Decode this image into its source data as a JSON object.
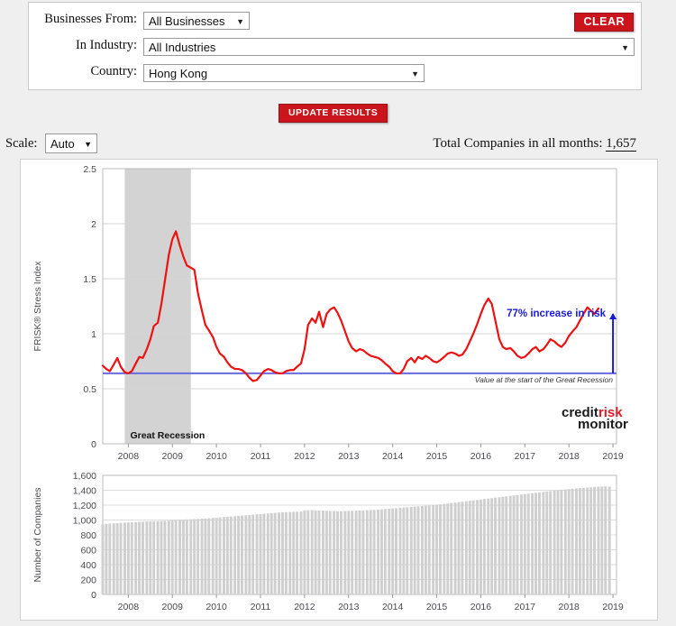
{
  "filters": {
    "businesses_from": {
      "label": "Businesses From:",
      "value": "All Businesses",
      "caret": "chevron-down-icon"
    },
    "in_industry": {
      "label": "In Industry:",
      "value": "All Industries",
      "caret": "chevron-down-icon"
    },
    "country": {
      "label": "Country:",
      "value": "Hong Kong",
      "caret": "chevron-down-icon"
    },
    "clear_label": "CLEAR"
  },
  "update_results_label": "UPDATE RESULTS",
  "scale": {
    "label": "Scale:",
    "value": "Auto",
    "caret": "chevron-down-icon"
  },
  "totals": {
    "prefix": "Total Companies in all months:",
    "value": "1,657"
  },
  "logo": {
    "part1": "credit",
    "part2": "risk",
    "part3": "monitor"
  },
  "colors": {
    "accent_red": "#c9151b",
    "line_red": "#ee1111",
    "baseline_blue": "#6a6ae0",
    "annotation_blue": "#1a1ad6",
    "recession_band": "#d3d3d3",
    "bar_gray": "#cfcfcf"
  },
  "chart_data": [
    {
      "type": "line",
      "id": "frisk-stress-index",
      "title": "",
      "xlabel": "",
      "ylabel": "FRISK® Stress Index",
      "ylim": [
        0,
        2.5
      ],
      "yticks": [
        0,
        0.5,
        1,
        1.5,
        2,
        2.5
      ],
      "ytick_labels": [
        "0",
        "0.5",
        "1",
        "1.5",
        "2",
        "2.5"
      ],
      "xlim": [
        2007.42,
        2019.08
      ],
      "xticks": [
        2008,
        2009,
        2010,
        2011,
        2012,
        2013,
        2014,
        2015,
        2016,
        2017,
        2018,
        2019
      ],
      "xtick_labels": [
        "2008",
        "2009",
        "2010",
        "2011",
        "2012",
        "2013",
        "2014",
        "2015",
        "2016",
        "2017",
        "2018",
        "2019"
      ],
      "grid": true,
      "legend": "none",
      "annotations": [
        {
          "name": "great-recession-band",
          "text": "Great Recession",
          "x_start": 2007.92,
          "x_end": 2009.42
        },
        {
          "name": "baseline-label",
          "text": "Value at the start of the Great Recession",
          "y": 0.64
        },
        {
          "name": "increase-callout",
          "text": "77% increase in risk"
        }
      ],
      "baseline_value": 0.64,
      "series": [
        {
          "name": "FRISK® Stress Index",
          "color": "#ee1111",
          "x": [
            2007.42,
            2007.5,
            2007.58,
            2007.67,
            2007.75,
            2007.83,
            2007.92,
            2008.0,
            2008.08,
            2008.17,
            2008.25,
            2008.33,
            2008.42,
            2008.5,
            2008.58,
            2008.67,
            2008.75,
            2008.83,
            2008.92,
            2009.0,
            2009.08,
            2009.17,
            2009.25,
            2009.33,
            2009.42,
            2009.5,
            2009.58,
            2009.67,
            2009.75,
            2009.83,
            2009.92,
            2010.0,
            2010.08,
            2010.17,
            2010.25,
            2010.33,
            2010.42,
            2010.5,
            2010.58,
            2010.67,
            2010.75,
            2010.83,
            2010.92,
            2011.0,
            2011.08,
            2011.17,
            2011.25,
            2011.33,
            2011.42,
            2011.5,
            2011.58,
            2011.67,
            2011.75,
            2011.83,
            2011.92,
            2012.0,
            2012.08,
            2012.17,
            2012.25,
            2012.33,
            2012.42,
            2012.5,
            2012.58,
            2012.67,
            2012.75,
            2012.83,
            2012.92,
            2013.0,
            2013.08,
            2013.17,
            2013.25,
            2013.33,
            2013.42,
            2013.5,
            2013.58,
            2013.67,
            2013.75,
            2013.83,
            2013.92,
            2014.0,
            2014.08,
            2014.17,
            2014.25,
            2014.33,
            2014.42,
            2014.5,
            2014.58,
            2014.67,
            2014.75,
            2014.83,
            2014.92,
            2015.0,
            2015.08,
            2015.17,
            2015.25,
            2015.33,
            2015.42,
            2015.5,
            2015.58,
            2015.67,
            2015.75,
            2015.83,
            2015.92,
            2016.0,
            2016.08,
            2016.17,
            2016.25,
            2016.33,
            2016.42,
            2016.5,
            2016.58,
            2016.67,
            2016.75,
            2016.83,
            2016.92,
            2017.0,
            2017.08,
            2017.17,
            2017.25,
            2017.33,
            2017.42,
            2017.5,
            2017.58,
            2017.67,
            2017.75,
            2017.83,
            2017.92,
            2018.0,
            2018.08,
            2018.17,
            2018.25,
            2018.33,
            2018.42,
            2018.5,
            2018.58,
            2018.67,
            2018.75,
            2018.83,
            2018.92,
            2019.0
          ],
          "y": [
            0.71,
            0.68,
            0.66,
            0.72,
            0.78,
            0.7,
            0.65,
            0.64,
            0.66,
            0.73,
            0.79,
            0.78,
            0.86,
            0.95,
            1.07,
            1.1,
            1.27,
            1.48,
            1.72,
            1.86,
            1.93,
            1.8,
            1.7,
            1.62,
            1.6,
            1.58,
            1.37,
            1.21,
            1.08,
            1.03,
            0.97,
            0.88,
            0.82,
            0.79,
            0.74,
            0.7,
            0.68,
            0.68,
            0.67,
            0.64,
            0.6,
            0.57,
            0.58,
            0.62,
            0.66,
            0.68,
            0.67,
            0.65,
            0.64,
            0.64,
            0.66,
            0.67,
            0.67,
            0.7,
            0.73,
            0.86,
            1.08,
            1.14,
            1.1,
            1.2,
            1.06,
            1.18,
            1.22,
            1.24,
            1.19,
            1.12,
            1.02,
            0.93,
            0.87,
            0.84,
            0.86,
            0.85,
            0.82,
            0.8,
            0.79,
            0.78,
            0.76,
            0.73,
            0.7,
            0.66,
            0.64,
            0.64,
            0.68,
            0.75,
            0.78,
            0.74,
            0.79,
            0.77,
            0.8,
            0.78,
            0.75,
            0.74,
            0.76,
            0.79,
            0.82,
            0.83,
            0.82,
            0.8,
            0.81,
            0.86,
            0.93,
            1.0,
            1.09,
            1.18,
            1.26,
            1.32,
            1.27,
            1.12,
            0.95,
            0.88,
            0.86,
            0.87,
            0.84,
            0.8,
            0.78,
            0.79,
            0.82,
            0.86,
            0.88,
            0.84,
            0.86,
            0.9,
            0.95,
            0.93,
            0.9,
            0.88,
            0.92,
            0.98,
            1.02,
            1.06,
            1.12,
            1.18,
            1.24,
            1.21,
            1.18,
            1.23
          ]
        }
      ]
    },
    {
      "type": "bar",
      "id": "number-of-companies",
      "title": "",
      "xlabel": "",
      "ylabel": "Number of Companies",
      "ylim": [
        0,
        1600
      ],
      "yticks": [
        0,
        200,
        400,
        600,
        800,
        1000,
        1200,
        1400,
        1600
      ],
      "ytick_labels": [
        "0",
        "200",
        "400",
        "600",
        "800",
        "1,000",
        "1,200",
        "1,400",
        "1,600"
      ],
      "xticks": [
        2008,
        2009,
        2010,
        2011,
        2012,
        2013,
        2014,
        2015,
        2016,
        2017,
        2018,
        2019
      ],
      "xtick_labels": [
        "2008",
        "2009",
        "2010",
        "2011",
        "2012",
        "2013",
        "2014",
        "2015",
        "2016",
        "2017",
        "2018",
        "2019"
      ],
      "grid": true,
      "legend": "none",
      "categories": [
        2007.42,
        2007.5,
        2007.58,
        2007.67,
        2007.75,
        2007.83,
        2007.92,
        2008.0,
        2008.08,
        2008.17,
        2008.25,
        2008.33,
        2008.42,
        2008.5,
        2008.58,
        2008.67,
        2008.75,
        2008.83,
        2008.92,
        2009.0,
        2009.08,
        2009.17,
        2009.25,
        2009.33,
        2009.42,
        2009.5,
        2009.58,
        2009.67,
        2009.75,
        2009.83,
        2009.92,
        2010.0,
        2010.08,
        2010.17,
        2010.25,
        2010.33,
        2010.42,
        2010.5,
        2010.58,
        2010.67,
        2010.75,
        2010.83,
        2010.92,
        2011.0,
        2011.08,
        2011.17,
        2011.25,
        2011.33,
        2011.42,
        2011.5,
        2011.58,
        2011.67,
        2011.75,
        2011.83,
        2011.92,
        2012.0,
        2012.08,
        2012.17,
        2012.25,
        2012.33,
        2012.42,
        2012.5,
        2012.58,
        2012.67,
        2012.75,
        2012.83,
        2012.92,
        2013.0,
        2013.08,
        2013.17,
        2013.25,
        2013.33,
        2013.42,
        2013.5,
        2013.58,
        2013.67,
        2013.75,
        2013.83,
        2013.92,
        2014.0,
        2014.08,
        2014.17,
        2014.25,
        2014.33,
        2014.42,
        2014.5,
        2014.58,
        2014.67,
        2014.75,
        2014.83,
        2014.92,
        2015.0,
        2015.08,
        2015.17,
        2015.25,
        2015.33,
        2015.42,
        2015.5,
        2015.58,
        2015.67,
        2015.75,
        2015.83,
        2015.92,
        2016.0,
        2016.08,
        2016.17,
        2016.25,
        2016.33,
        2016.42,
        2016.5,
        2016.58,
        2016.67,
        2016.75,
        2016.83,
        2016.92,
        2017.0,
        2017.08,
        2017.17,
        2017.25,
        2017.33,
        2017.42,
        2017.5,
        2017.58,
        2017.67,
        2017.75,
        2017.83,
        2017.92,
        2018.0,
        2018.08,
        2018.17,
        2018.25,
        2018.33,
        2018.42,
        2018.5,
        2018.58,
        2018.67,
        2018.75,
        2018.83,
        2018.92,
        2019.0
      ],
      "values": [
        940,
        948,
        952,
        955,
        958,
        962,
        965,
        968,
        970,
        972,
        975,
        978,
        980,
        982,
        984,
        986,
        988,
        990,
        992,
        1000,
        1002,
        1004,
        1006,
        1008,
        1010,
        1012,
        1015,
        1018,
        1020,
        1024,
        1028,
        1032,
        1036,
        1040,
        1044,
        1048,
        1052,
        1056,
        1060,
        1064,
        1068,
        1072,
        1076,
        1080,
        1084,
        1088,
        1092,
        1096,
        1100,
        1104,
        1106,
        1108,
        1110,
        1112,
        1114,
        1130,
        1132,
        1134,
        1130,
        1128,
        1126,
        1124,
        1122,
        1120,
        1118,
        1118,
        1120,
        1122,
        1124,
        1126,
        1128,
        1130,
        1132,
        1134,
        1136,
        1140,
        1144,
        1148,
        1152,
        1156,
        1160,
        1164,
        1168,
        1172,
        1176,
        1180,
        1184,
        1188,
        1192,
        1196,
        1200,
        1204,
        1210,
        1216,
        1222,
        1228,
        1234,
        1240,
        1246,
        1252,
        1258,
        1264,
        1270,
        1276,
        1282,
        1288,
        1294,
        1300,
        1306,
        1312,
        1318,
        1324,
        1330,
        1336,
        1342,
        1348,
        1354,
        1360,
        1366,
        1372,
        1378,
        1384,
        1390,
        1396,
        1402,
        1408,
        1412,
        1416,
        1420,
        1424,
        1428,
        1432,
        1436,
        1440,
        1444,
        1448,
        1450,
        1452,
        1450
      ]
    }
  ]
}
